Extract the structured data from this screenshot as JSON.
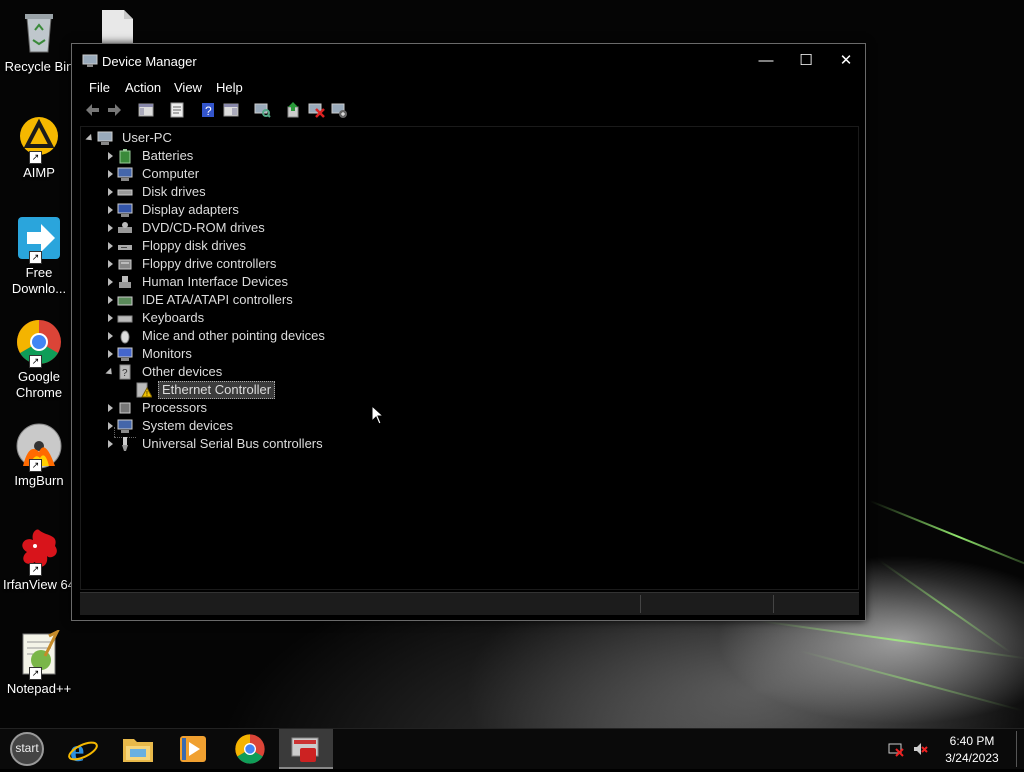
{
  "desktop": {
    "icons": [
      {
        "label": "Recycle Bin"
      },
      {
        "label": "AIMP"
      },
      {
        "label": "Free Downlo..."
      },
      {
        "label": "Google Chrome"
      },
      {
        "label": "ImgBurn"
      },
      {
        "label": "IrfanView 64"
      },
      {
        "label": "Notepad++"
      }
    ]
  },
  "window": {
    "title": "Device Manager",
    "controls": {
      "minimize": "—",
      "maximize": "☐",
      "close": "✕"
    },
    "menu": [
      "File",
      "Action",
      "View",
      "Help"
    ],
    "tree": {
      "root": "User-PC",
      "categories": [
        {
          "label": "Batteries"
        },
        {
          "label": "Computer"
        },
        {
          "label": "Disk drives"
        },
        {
          "label": "Display adapters"
        },
        {
          "label": "DVD/CD-ROM drives"
        },
        {
          "label": "Floppy disk drives"
        },
        {
          "label": "Floppy drive controllers"
        },
        {
          "label": "Human Interface Devices"
        },
        {
          "label": "IDE ATA/ATAPI controllers"
        },
        {
          "label": "Keyboards"
        },
        {
          "label": "Mice and other pointing devices"
        },
        {
          "label": "Monitors"
        },
        {
          "label": "Other devices"
        },
        {
          "label": "Ethernet Controller"
        },
        {
          "label": "Processors"
        },
        {
          "label": "System devices"
        },
        {
          "label": "Universal Serial Bus controllers"
        }
      ]
    }
  },
  "taskbar": {
    "start_label": "start",
    "time": "6:40 PM",
    "date": "3/24/2023"
  },
  "colors": {
    "window_bg": "#000000",
    "selection": "#3b3b3b",
    "warning": "#f2c200"
  }
}
